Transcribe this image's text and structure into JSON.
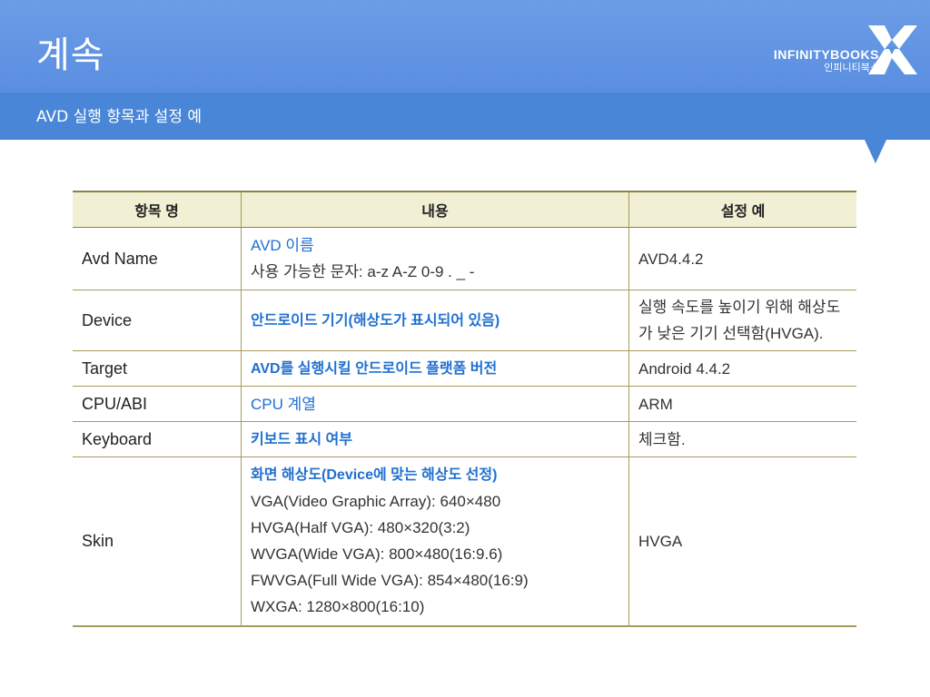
{
  "slide": {
    "title": "계속",
    "subtitle": "AVD 실행 항목과 설정 예"
  },
  "logo": {
    "name": "INFINITYBOOKS",
    "korean": "인피니티북스"
  },
  "table": {
    "headers": [
      "항목 명",
      "내용",
      "설정 예"
    ],
    "rows": [
      {
        "item": "Avd Name",
        "desc_title": "AVD 이름",
        "desc_lines": [
          "사용 가능한 문자: a-z A-Z 0-9 . _ -"
        ],
        "example": [
          "AVD4.4.2"
        ]
      },
      {
        "item": "Device",
        "desc_title": "안드로이드 기기(해상도가 표시되어 있음)",
        "desc_lines": [],
        "example": [
          "실행 속도를 높이기 위해 해상도",
          "가 낮은 기기 선택함(HVGA)."
        ]
      },
      {
        "item": "Target",
        "desc_title": "AVD를 실행시킬 안드로이드 플랫폼 버전",
        "desc_lines": [],
        "example": [
          "Android 4.4.2"
        ]
      },
      {
        "item": "CPU/ABI",
        "desc_title": "CPU 계열",
        "desc_lines": [],
        "example": [
          "ARM"
        ]
      },
      {
        "item": "Keyboard",
        "desc_title": "키보드 표시 여부",
        "desc_lines": [],
        "example": [
          "체크함."
        ]
      },
      {
        "item": "Skin",
        "desc_title": "화면 해상도(Device에 맞는 해상도 선정)",
        "desc_lines": [
          "VGA(Video Graphic Array): 640×480",
          "HVGA(Half VGA): 480×320(3:2)",
          "WVGA(Wide VGA): 800×480(16:9.6)",
          "FWVGA(Full Wide VGA): 854×480(16:9)",
          "WXGA: 1280×800(16:10)"
        ],
        "example": [
          "HVGA"
        ]
      }
    ]
  },
  "colors": {
    "header": "#5a8ee0",
    "subbar": "#4a86d8",
    "table_header_bg": "#f1efd4",
    "accent_text": "#1f6fd1",
    "rule": "#a89a5a"
  }
}
